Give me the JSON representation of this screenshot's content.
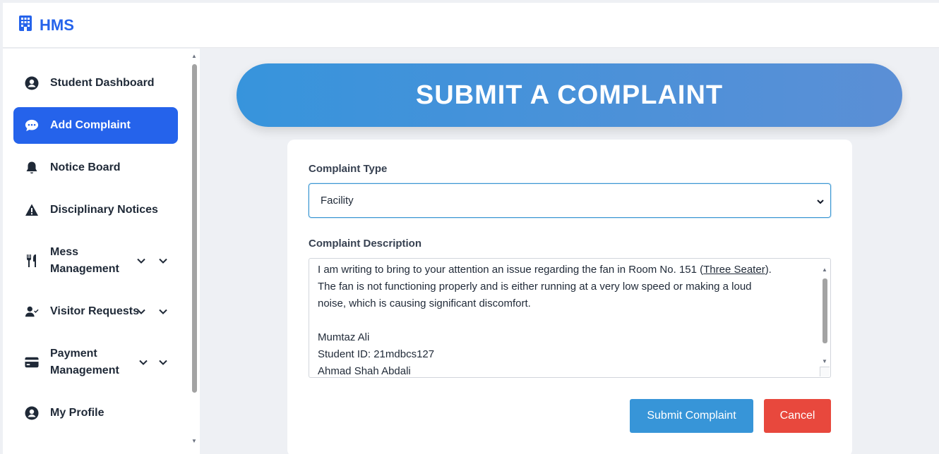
{
  "app": {
    "brand": "HMS",
    "brand_icon": "building-icon",
    "accent": "#2563eb"
  },
  "sidebar": {
    "items": [
      {
        "label": "Student Dashboard",
        "icon": "user-circle-icon",
        "active": false
      },
      {
        "label": "Add Complaint",
        "icon": "chat-bubble-icon",
        "active": true
      },
      {
        "label": "Notice Board",
        "icon": "bell-icon",
        "active": false
      },
      {
        "label": "Disciplinary Notices",
        "icon": "warning-triangle-icon",
        "active": false
      },
      {
        "label": "Mess Management",
        "icon": "utensils-icon",
        "active": false,
        "expandable": true
      },
      {
        "label": "Visitor Requests",
        "icon": "user-check-icon",
        "active": false,
        "expandable": true
      },
      {
        "label": "Payment Management",
        "icon": "credit-card-icon",
        "active": false,
        "expandable": true
      },
      {
        "label": "My Profile",
        "icon": "user-circle-icon",
        "active": false
      }
    ]
  },
  "main": {
    "banner_title": "SUBMIT A COMPLAINT",
    "form": {
      "type_label": "Complaint Type",
      "type_value": "Facility",
      "description_label": "Complaint Description",
      "description_lines": [
        "I am writing to bring to your attention an issue regarding the fan in Room No. 151 (",
        "Three Seater",
        ").",
        "The fan is not functioning properly and is either running at a very low speed or making a loud",
        "noise, which is causing significant discomfort.",
        "",
        "Mumtaz Ali",
        "Student ID: 21mdbcs127",
        "Ahmad Shah Abdali"
      ],
      "submit_label": "Submit Complaint",
      "cancel_label": "Cancel"
    }
  },
  "colors": {
    "submit": "#3795d8",
    "cancel": "#e8483d",
    "banner_start": "#3794dc",
    "banner_end": "#5b8fd6"
  }
}
